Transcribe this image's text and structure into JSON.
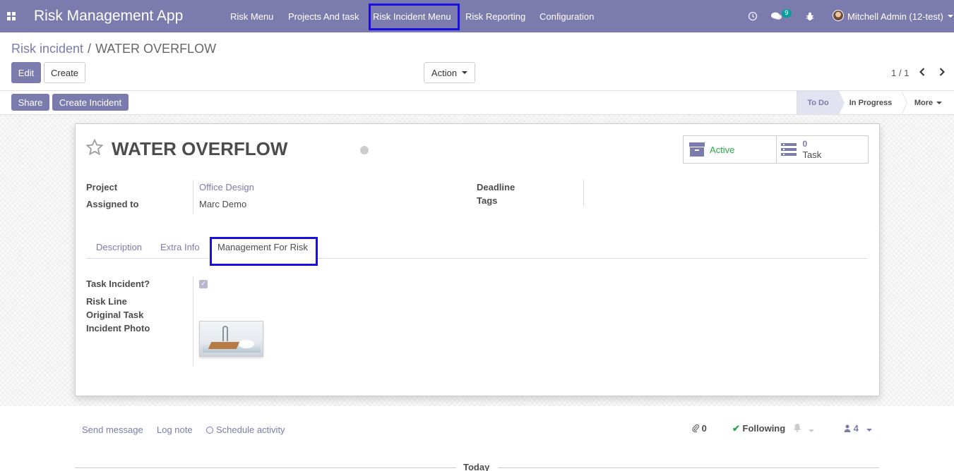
{
  "navbar": {
    "apps_icon": "apps-grid-icon",
    "brand": "Risk Management App",
    "menus": [
      "Risk Menu",
      "Projects And task",
      "Risk Incident Menu",
      "Risk Reporting",
      "Configuration"
    ],
    "highlighted_menu": "Risk Incident Menu",
    "messages_count": "9",
    "user": "Mitchell Admin (12-test)",
    "colors": {
      "bar": "#7c7bad",
      "highlight": "#1a0fe0"
    }
  },
  "breadcrumb": {
    "parent": "Risk incident",
    "separator": "/",
    "current": "WATER OVERFLOW"
  },
  "controls": {
    "edit": "Edit",
    "create": "Create",
    "action": "Action",
    "pager": "1 / 1"
  },
  "statusbar": {
    "buttons": [
      "Share",
      "Create Incident"
    ],
    "stages": [
      "To Do",
      "In Progress",
      "More"
    ],
    "current_stage": "To Do"
  },
  "record": {
    "title": "WATER OVERFLOW",
    "smart_buttons": {
      "active_label": "Active",
      "task_count": "0",
      "task_label": "Task"
    },
    "fields_left": [
      {
        "label": "Project",
        "value": "Office Design"
      },
      {
        "label": "Assigned to",
        "value": "Marc Demo"
      }
    ],
    "fields_right": [
      {
        "label": "Deadline",
        "value": ""
      },
      {
        "label": "Tags",
        "value": ""
      }
    ],
    "tabs": [
      "Description",
      "Extra Info",
      "Management For Risk"
    ],
    "active_tab": "Management For Risk",
    "risk_fields": [
      {
        "label": "Task Incident?",
        "value": "checked"
      },
      {
        "label": "Risk Line",
        "value": ""
      },
      {
        "label": "Original Task",
        "value": ""
      },
      {
        "label": "Incident Photo",
        "value": ""
      }
    ]
  },
  "chatter": {
    "send_message": "Send message",
    "log_note": "Log note",
    "schedule_activity": "Schedule activity",
    "attachments": "0",
    "following": "Following",
    "followers": "4",
    "today": "Today"
  }
}
